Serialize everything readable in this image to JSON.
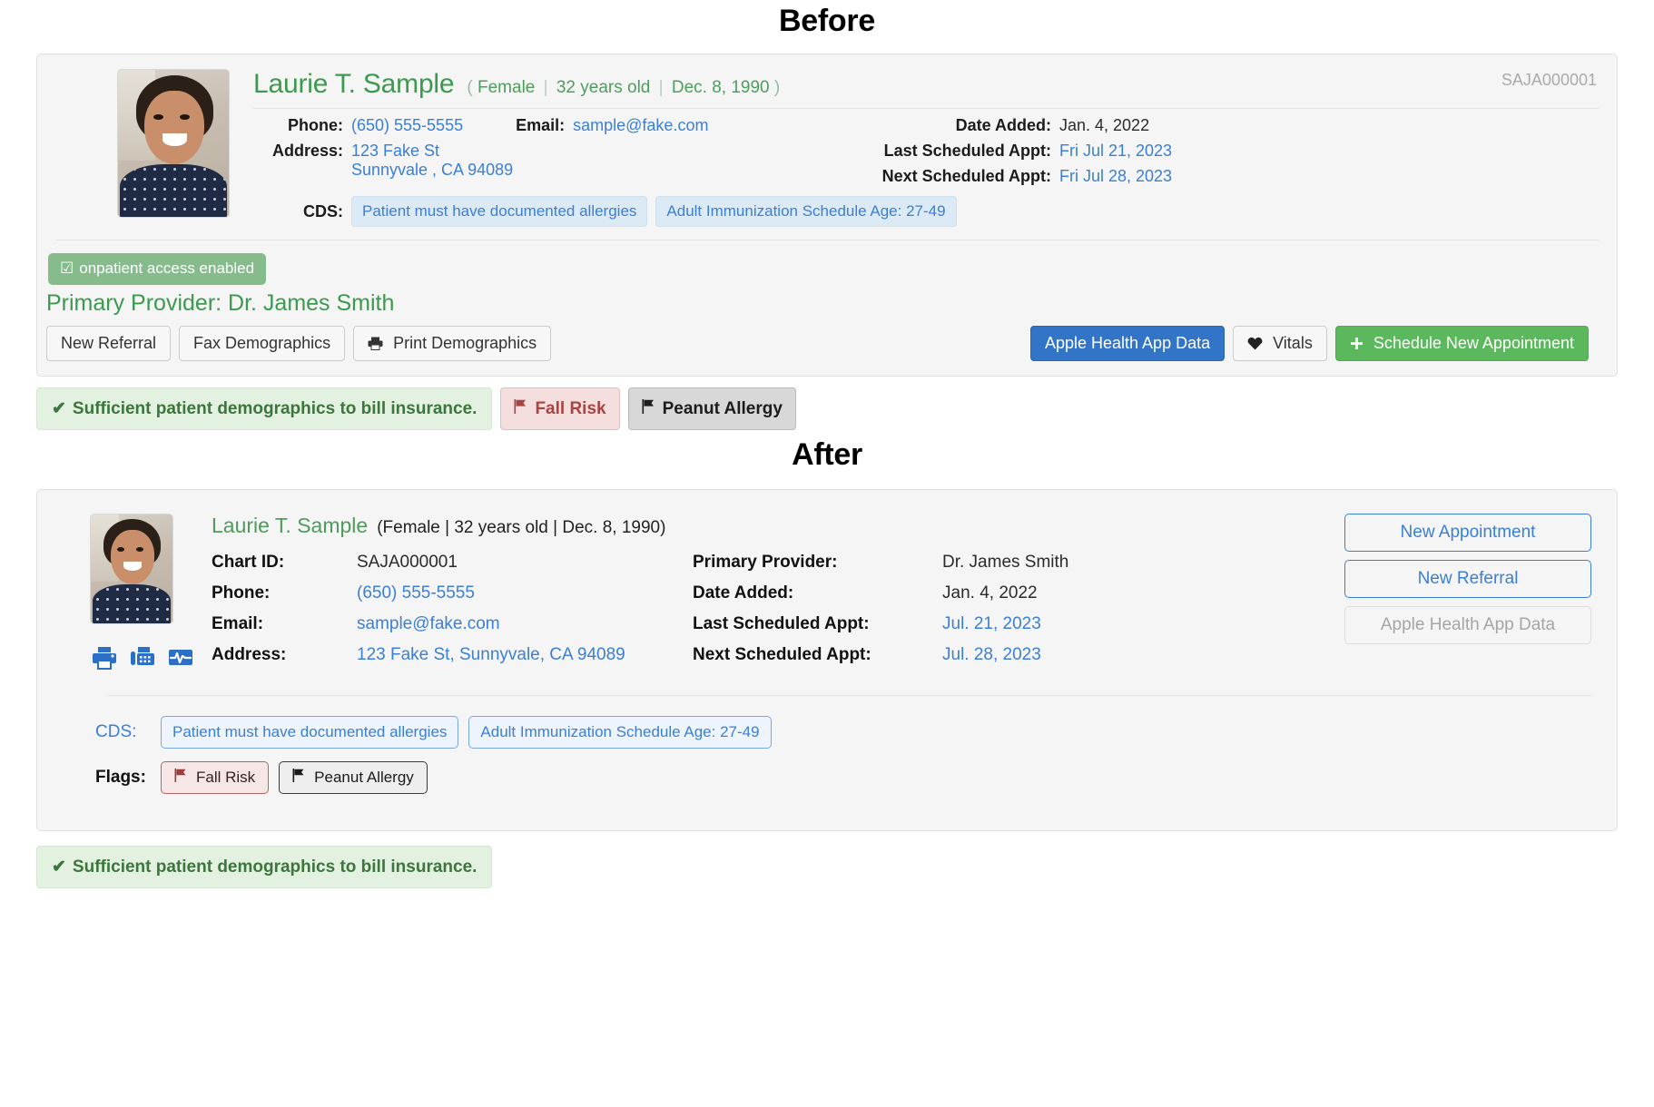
{
  "sections": {
    "before_title": "Before",
    "after_title": "After"
  },
  "patient": {
    "name": "Laurie T. Sample",
    "meta_before": {
      "open_paren": "(",
      "gender": "Female",
      "age": "32 years old",
      "dob": "Dec. 8, 1990",
      "close_paren": ")",
      "sep": "|"
    },
    "meta_after": "(Female | 32 years old | Dec. 8, 1990)",
    "chart_id": "SAJA000001",
    "phone": "(650) 555-5555",
    "email": "sample@fake.com",
    "address_line1": "123 Fake St",
    "address_line2": "Sunnyvale , CA 94089",
    "address_single": "123 Fake St, Sunnyvale, CA 94089",
    "primary_provider": "Dr. James Smith",
    "date_added": "Jan. 4, 2022",
    "last_appt_before": "Fri Jul 21, 2023",
    "next_appt_before": "Fri Jul 28, 2023",
    "last_appt_after": "Jul. 21, 2023",
    "next_appt_after": "Jul. 28, 2023"
  },
  "labels": {
    "phone": "Phone:",
    "email": "Email:",
    "address": "Address:",
    "cds": "CDS:",
    "flags": "Flags:",
    "chart_id": "Chart ID:",
    "date_added": "Date Added:",
    "last_appt": "Last Scheduled Appt:",
    "next_appt": "Next Scheduled Appt:",
    "primary_provider": "Primary Provider:"
  },
  "before": {
    "onpatient_badge": "onpatient access enabled",
    "onpatient_check": "☑",
    "primary_provider_line": "Primary Provider: Dr. James Smith",
    "cds_pills": [
      "Patient must have documented allergies",
      "Adult Immunization Schedule Age: 27-49"
    ],
    "buttons_left": [
      {
        "label": "New Referral",
        "icon": ""
      },
      {
        "label": "Fax Demographics",
        "icon": ""
      },
      {
        "label": "Print Demographics",
        "icon": "printer-icon"
      }
    ],
    "buttons_right": [
      {
        "label": "Apple Health App Data",
        "style": "primary"
      },
      {
        "label": "Vitals",
        "style": "default",
        "icon": "heart-icon"
      },
      {
        "label": "Schedule New Appointment",
        "style": "success",
        "icon": "plus-icon"
      }
    ],
    "alert": "Sufficient patient demographics to bill insurance.",
    "alert_check": "✔",
    "flags": [
      {
        "label": "Fall Risk",
        "style": "red"
      },
      {
        "label": "Peanut Allergy",
        "style": "dark"
      }
    ]
  },
  "after": {
    "icons": [
      "print-icon",
      "fax-icon",
      "vitals-icon"
    ],
    "actions": [
      {
        "label": "New Appointment",
        "disabled": false
      },
      {
        "label": "New Referral",
        "disabled": false
      },
      {
        "label": "Apple Health App Data",
        "disabled": true
      }
    ],
    "cds_pills": [
      "Patient must have documented allergies",
      "Adult Immunization Schedule Age: 27-49"
    ],
    "flags": [
      {
        "label": "Fall Risk",
        "style": "red"
      },
      {
        "label": "Peanut Allergy",
        "style": "dark"
      }
    ],
    "alert": "Sufficient patient demographics to bill insurance.",
    "alert_check": "✔"
  },
  "colors": {
    "green": "#3c9a4f",
    "blue_link": "#3b7fd4",
    "primary_btn": "#3174c8",
    "success_btn": "#5cb85c",
    "flag_red": "#a94442",
    "muted": "#aaaaaa"
  }
}
